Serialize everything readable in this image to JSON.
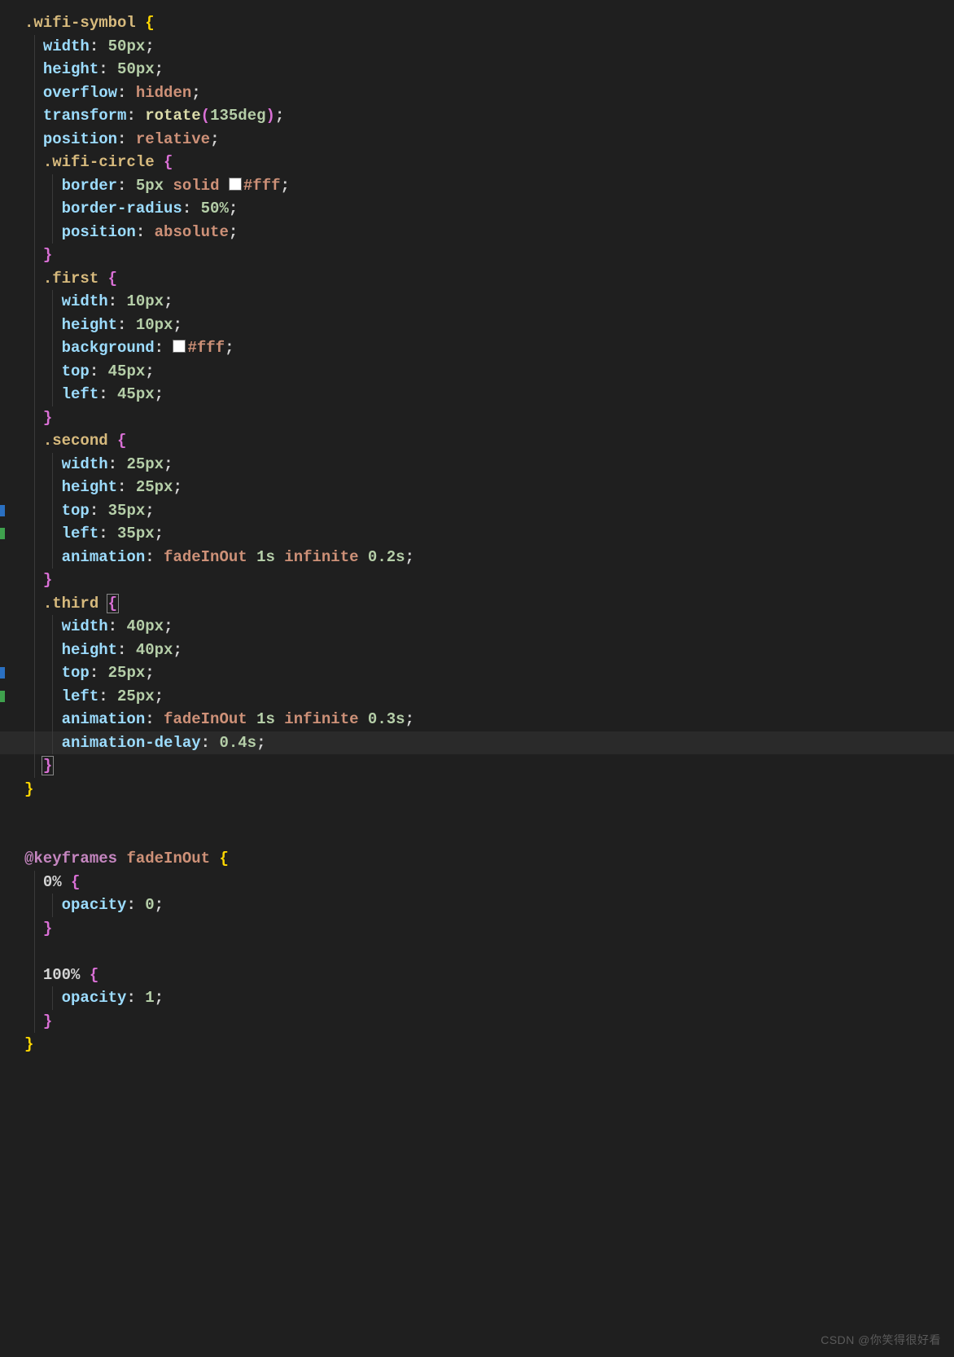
{
  "watermark": "CSDN @你笑得很好看",
  "lines": [
    {
      "id": "l0",
      "indent": 0,
      "tokens": [
        {
          "t": ".wifi-symbol ",
          "c": "sel"
        },
        {
          "t": "{",
          "c": "brace-ob"
        }
      ]
    },
    {
      "id": "l1",
      "indent": 1,
      "guides": [
        1
      ],
      "tokens": [
        {
          "t": "width",
          "c": "prop"
        },
        {
          "t": ": ",
          "c": "colon"
        },
        {
          "t": "50",
          "c": "num"
        },
        {
          "t": "px",
          "c": "unit"
        },
        {
          "t": ";",
          "c": "semi"
        }
      ]
    },
    {
      "id": "l2",
      "indent": 1,
      "guides": [
        1
      ],
      "tokens": [
        {
          "t": "height",
          "c": "prop"
        },
        {
          "t": ": ",
          "c": "colon"
        },
        {
          "t": "50",
          "c": "num"
        },
        {
          "t": "px",
          "c": "unit"
        },
        {
          "t": ";",
          "c": "semi"
        }
      ]
    },
    {
      "id": "l3",
      "indent": 1,
      "guides": [
        1
      ],
      "tokens": [
        {
          "t": "overflow",
          "c": "prop"
        },
        {
          "t": ": ",
          "c": "colon"
        },
        {
          "t": "hidden",
          "c": "kw"
        },
        {
          "t": ";",
          "c": "semi"
        }
      ]
    },
    {
      "id": "l4",
      "indent": 1,
      "guides": [
        1
      ],
      "tokens": [
        {
          "t": "transform",
          "c": "prop"
        },
        {
          "t": ": ",
          "c": "colon"
        },
        {
          "t": "rotate",
          "c": "func"
        },
        {
          "t": "(",
          "c": "paren"
        },
        {
          "t": "135",
          "c": "num"
        },
        {
          "t": "deg",
          "c": "unit"
        },
        {
          "t": ")",
          "c": "paren"
        },
        {
          "t": ";",
          "c": "semi"
        }
      ]
    },
    {
      "id": "l5",
      "indent": 1,
      "guides": [
        1
      ],
      "tokens": [
        {
          "t": "position",
          "c": "prop"
        },
        {
          "t": ": ",
          "c": "colon"
        },
        {
          "t": "relative",
          "c": "kw"
        },
        {
          "t": ";",
          "c": "semi"
        }
      ]
    },
    {
      "id": "l6",
      "indent": 1,
      "guides": [
        1
      ],
      "tokens": [
        {
          "t": ".wifi-circle ",
          "c": "sel"
        },
        {
          "t": "{",
          "c": "brace"
        }
      ]
    },
    {
      "id": "l7",
      "indent": 2,
      "guides": [
        1,
        2
      ],
      "tokens": [
        {
          "t": "border",
          "c": "prop"
        },
        {
          "t": ": ",
          "c": "colon"
        },
        {
          "t": "5",
          "c": "num"
        },
        {
          "t": "px",
          "c": "unit"
        },
        {
          "t": " ",
          "c": "colon"
        },
        {
          "t": "solid",
          "c": "kw"
        },
        {
          "t": " ",
          "c": "colon"
        },
        {
          "swatch": true
        },
        {
          "t": "#fff",
          "c": "hex"
        },
        {
          "t": ";",
          "c": "semi"
        }
      ]
    },
    {
      "id": "l8",
      "indent": 2,
      "guides": [
        1,
        2
      ],
      "tokens": [
        {
          "t": "border-radius",
          "c": "prop"
        },
        {
          "t": ": ",
          "c": "colon"
        },
        {
          "t": "50",
          "c": "num"
        },
        {
          "t": "%",
          "c": "unit"
        },
        {
          "t": ";",
          "c": "semi"
        }
      ]
    },
    {
      "id": "l9",
      "indent": 2,
      "guides": [
        1,
        2
      ],
      "tokens": [
        {
          "t": "position",
          "c": "prop"
        },
        {
          "t": ": ",
          "c": "colon"
        },
        {
          "t": "absolute",
          "c": "kw"
        },
        {
          "t": ";",
          "c": "semi"
        }
      ]
    },
    {
      "id": "l10",
      "indent": 1,
      "guides": [
        1
      ],
      "tokens": [
        {
          "t": "}",
          "c": "brace"
        }
      ]
    },
    {
      "id": "l11",
      "indent": 1,
      "guides": [
        1
      ],
      "tokens": [
        {
          "t": ".first ",
          "c": "sel"
        },
        {
          "t": "{",
          "c": "brace"
        }
      ]
    },
    {
      "id": "l12",
      "indent": 2,
      "guides": [
        1,
        2
      ],
      "tokens": [
        {
          "t": "width",
          "c": "prop"
        },
        {
          "t": ": ",
          "c": "colon"
        },
        {
          "t": "10",
          "c": "num"
        },
        {
          "t": "px",
          "c": "unit"
        },
        {
          "t": ";",
          "c": "semi"
        }
      ]
    },
    {
      "id": "l13",
      "indent": 2,
      "guides": [
        1,
        2
      ],
      "tokens": [
        {
          "t": "height",
          "c": "prop"
        },
        {
          "t": ": ",
          "c": "colon"
        },
        {
          "t": "10",
          "c": "num"
        },
        {
          "t": "px",
          "c": "unit"
        },
        {
          "t": ";",
          "c": "semi"
        }
      ]
    },
    {
      "id": "l14",
      "indent": 2,
      "guides": [
        1,
        2
      ],
      "tokens": [
        {
          "t": "background",
          "c": "prop"
        },
        {
          "t": ": ",
          "c": "colon"
        },
        {
          "swatch": true
        },
        {
          "t": "#fff",
          "c": "hex"
        },
        {
          "t": ";",
          "c": "semi"
        }
      ]
    },
    {
      "id": "l15",
      "indent": 2,
      "guides": [
        1,
        2
      ],
      "tokens": [
        {
          "t": "top",
          "c": "prop"
        },
        {
          "t": ": ",
          "c": "colon"
        },
        {
          "t": "45",
          "c": "num"
        },
        {
          "t": "px",
          "c": "unit"
        },
        {
          "t": ";",
          "c": "semi"
        }
      ]
    },
    {
      "id": "l16",
      "indent": 2,
      "guides": [
        1,
        2
      ],
      "tokens": [
        {
          "t": "left",
          "c": "prop"
        },
        {
          "t": ": ",
          "c": "colon"
        },
        {
          "t": "45",
          "c": "num"
        },
        {
          "t": "px",
          "c": "unit"
        },
        {
          "t": ";",
          "c": "semi"
        }
      ]
    },
    {
      "id": "l17",
      "indent": 1,
      "guides": [
        1
      ],
      "tokens": [
        {
          "t": "}",
          "c": "brace"
        }
      ]
    },
    {
      "id": "l18",
      "indent": 1,
      "guides": [
        1
      ],
      "tokens": [
        {
          "t": ".second ",
          "c": "sel"
        },
        {
          "t": "{",
          "c": "brace"
        }
      ]
    },
    {
      "id": "l19",
      "indent": 2,
      "guides": [
        1,
        2
      ],
      "tokens": [
        {
          "t": "width",
          "c": "prop"
        },
        {
          "t": ": ",
          "c": "colon"
        },
        {
          "t": "25",
          "c": "num"
        },
        {
          "t": "px",
          "c": "unit"
        },
        {
          "t": ";",
          "c": "semi"
        }
      ]
    },
    {
      "id": "l20",
      "indent": 2,
      "guides": [
        1,
        2
      ],
      "tokens": [
        {
          "t": "height",
          "c": "prop"
        },
        {
          "t": ": ",
          "c": "colon"
        },
        {
          "t": "25",
          "c": "num"
        },
        {
          "t": "px",
          "c": "unit"
        },
        {
          "t": ";",
          "c": "semi"
        }
      ]
    },
    {
      "id": "l21",
      "indent": 2,
      "guides": [
        1,
        2
      ],
      "bar": "blue",
      "tokens": [
        {
          "t": "top",
          "c": "prop"
        },
        {
          "t": ": ",
          "c": "colon"
        },
        {
          "t": "35",
          "c": "num"
        },
        {
          "t": "px",
          "c": "unit"
        },
        {
          "t": ";",
          "c": "semi"
        }
      ]
    },
    {
      "id": "l22",
      "indent": 2,
      "guides": [
        1,
        2
      ],
      "bar": "green",
      "tokens": [
        {
          "t": "left",
          "c": "prop"
        },
        {
          "t": ": ",
          "c": "colon"
        },
        {
          "t": "35",
          "c": "num"
        },
        {
          "t": "px",
          "c": "unit"
        },
        {
          "t": ";",
          "c": "semi"
        }
      ]
    },
    {
      "id": "l23",
      "indent": 2,
      "guides": [
        1,
        2
      ],
      "tokens": [
        {
          "t": "animation",
          "c": "prop"
        },
        {
          "t": ": ",
          "c": "colon"
        },
        {
          "t": "fadeInOut ",
          "c": "ident"
        },
        {
          "t": "1",
          "c": "num"
        },
        {
          "t": "s",
          "c": "unit"
        },
        {
          "t": " ",
          "c": "colon"
        },
        {
          "t": "infinite",
          "c": "kw"
        },
        {
          "t": " ",
          "c": "colon"
        },
        {
          "t": "0.2",
          "c": "num"
        },
        {
          "t": "s",
          "c": "unit"
        },
        {
          "t": ";",
          "c": "semi"
        }
      ]
    },
    {
      "id": "l24",
      "indent": 1,
      "guides": [
        1
      ],
      "tokens": [
        {
          "t": "}",
          "c": "brace"
        }
      ]
    },
    {
      "id": "l25",
      "indent": 1,
      "guides": [
        1
      ],
      "tokens": [
        {
          "t": ".third ",
          "c": "sel"
        },
        {
          "t": "{",
          "c": "brace-box"
        }
      ]
    },
    {
      "id": "l26",
      "indent": 2,
      "guides": [
        1,
        2
      ],
      "tokens": [
        {
          "t": "width",
          "c": "prop"
        },
        {
          "t": ": ",
          "c": "colon"
        },
        {
          "t": "40",
          "c": "num"
        },
        {
          "t": "px",
          "c": "unit"
        },
        {
          "t": ";",
          "c": "semi"
        }
      ]
    },
    {
      "id": "l27",
      "indent": 2,
      "guides": [
        1,
        2
      ],
      "tokens": [
        {
          "t": "height",
          "c": "prop"
        },
        {
          "t": ": ",
          "c": "colon"
        },
        {
          "t": "40",
          "c": "num"
        },
        {
          "t": "px",
          "c": "unit"
        },
        {
          "t": ";",
          "c": "semi"
        }
      ]
    },
    {
      "id": "l28",
      "indent": 2,
      "guides": [
        1,
        2
      ],
      "bar": "blue",
      "tokens": [
        {
          "t": "top",
          "c": "prop"
        },
        {
          "t": ": ",
          "c": "colon"
        },
        {
          "t": "25",
          "c": "num"
        },
        {
          "t": "px",
          "c": "unit"
        },
        {
          "t": ";",
          "c": "semi"
        }
      ]
    },
    {
      "id": "l29",
      "indent": 2,
      "guides": [
        1,
        2
      ],
      "bar": "green",
      "tokens": [
        {
          "t": "left",
          "c": "prop"
        },
        {
          "t": ": ",
          "c": "colon"
        },
        {
          "t": "25",
          "c": "num"
        },
        {
          "t": "px",
          "c": "unit"
        },
        {
          "t": ";",
          "c": "semi"
        }
      ]
    },
    {
      "id": "l30",
      "indent": 2,
      "guides": [
        1,
        2
      ],
      "tokens": [
        {
          "t": "animation",
          "c": "prop"
        },
        {
          "t": ": ",
          "c": "colon"
        },
        {
          "t": "fadeInOut ",
          "c": "ident"
        },
        {
          "t": "1",
          "c": "num"
        },
        {
          "t": "s",
          "c": "unit"
        },
        {
          "t": " ",
          "c": "colon"
        },
        {
          "t": "infinite",
          "c": "kw"
        },
        {
          "t": " ",
          "c": "colon"
        },
        {
          "t": "0.3",
          "c": "num"
        },
        {
          "t": "s",
          "c": "unit"
        },
        {
          "t": ";",
          "c": "semi"
        }
      ]
    },
    {
      "id": "l31",
      "indent": 2,
      "guides": [
        1,
        2
      ],
      "hl": true,
      "tokens": [
        {
          "t": "animation-delay",
          "c": "prop"
        },
        {
          "t": ": ",
          "c": "colon"
        },
        {
          "t": "0.4",
          "c": "num"
        },
        {
          "t": "s",
          "c": "unit"
        },
        {
          "t": ";",
          "c": "semi"
        }
      ]
    },
    {
      "id": "l32",
      "indent": 1,
      "guides": [
        1
      ],
      "tokens": [
        {
          "t": "}",
          "c": "brace-box"
        }
      ]
    },
    {
      "id": "l33",
      "indent": 0,
      "tokens": [
        {
          "t": "}",
          "c": "brace-ob"
        }
      ]
    },
    {
      "id": "l34",
      "indent": 0,
      "tokens": []
    },
    {
      "id": "l35",
      "indent": 0,
      "tokens": []
    },
    {
      "id": "l36",
      "indent": 0,
      "tokens": [
        {
          "t": "@keyframes",
          "c": "at"
        },
        {
          "t": " ",
          "c": "colon"
        },
        {
          "t": "fadeInOut ",
          "c": "ident"
        },
        {
          "t": "{",
          "c": "brace-ob"
        }
      ]
    },
    {
      "id": "l37",
      "indent": 1,
      "guides": [
        1
      ],
      "tokens": [
        {
          "t": "0% ",
          "c": "pct"
        },
        {
          "t": "{",
          "c": "brace"
        }
      ]
    },
    {
      "id": "l38",
      "indent": 2,
      "guides": [
        1,
        2
      ],
      "tokens": [
        {
          "t": "opacity",
          "c": "prop"
        },
        {
          "t": ": ",
          "c": "colon"
        },
        {
          "t": "0",
          "c": "num"
        },
        {
          "t": ";",
          "c": "semi"
        }
      ]
    },
    {
      "id": "l39",
      "indent": 1,
      "guides": [
        1
      ],
      "tokens": [
        {
          "t": "}",
          "c": "brace"
        }
      ]
    },
    {
      "id": "l40",
      "indent": 0,
      "guides": [
        1
      ],
      "tokens": []
    },
    {
      "id": "l41",
      "indent": 1,
      "guides": [
        1
      ],
      "tokens": [
        {
          "t": "100% ",
          "c": "pct"
        },
        {
          "t": "{",
          "c": "brace"
        }
      ]
    },
    {
      "id": "l42",
      "indent": 2,
      "guides": [
        1,
        2
      ],
      "tokens": [
        {
          "t": "opacity",
          "c": "prop"
        },
        {
          "t": ": ",
          "c": "colon"
        },
        {
          "t": "1",
          "c": "num"
        },
        {
          "t": ";",
          "c": "semi"
        }
      ]
    },
    {
      "id": "l43",
      "indent": 1,
      "guides": [
        1
      ],
      "tokens": [
        {
          "t": "}",
          "c": "brace"
        }
      ]
    },
    {
      "id": "l44",
      "indent": 0,
      "tokens": [
        {
          "t": "}",
          "c": "brace-ob"
        }
      ]
    }
  ]
}
